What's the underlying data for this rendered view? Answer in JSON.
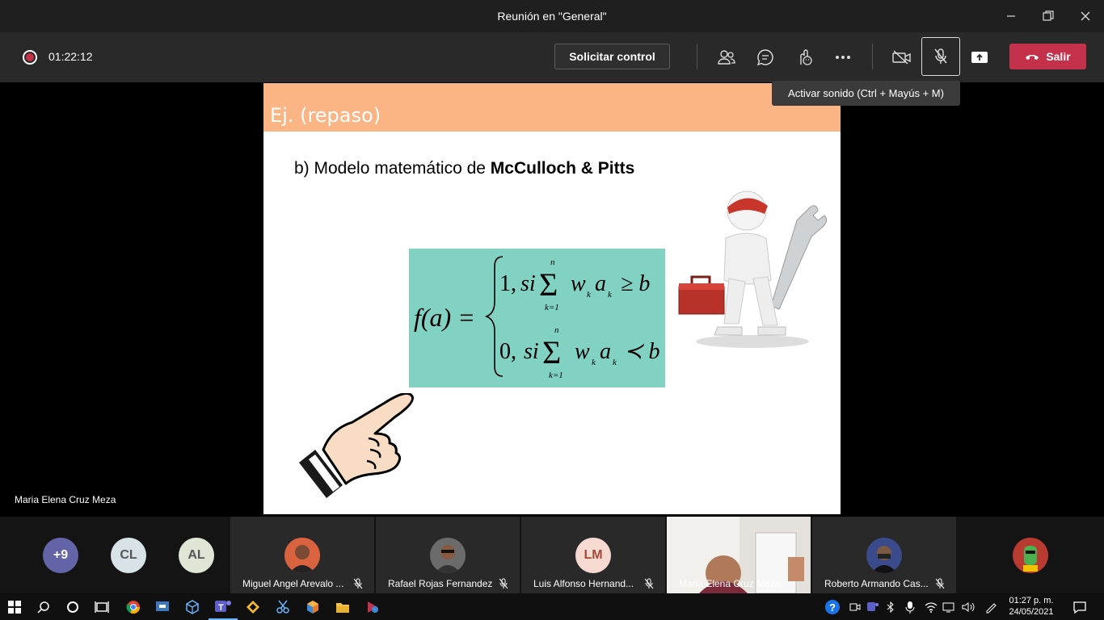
{
  "window": {
    "title": "Reunión en \"General\""
  },
  "toolbar": {
    "timer": "01:22:12",
    "request_control_label": "Solicitar control",
    "leave_label": "Salir",
    "tooltip": "Activar sonido (Ctrl + Mayús + M)"
  },
  "stage": {
    "presenter_name": "Maria Elena Cruz Meza"
  },
  "slide": {
    "title": "Ej. (repaso)",
    "subtitle_prefix": "b) Modelo matemático de ",
    "subtitle_bold_1": "McCulloch & Pitt",
    "subtitle_suffix": "s",
    "formula": {
      "lhs": "f(a) =",
      "case1": "1, si Σ w",
      "case1_rel": "≥ b",
      "case2": "0, si Σ w",
      "case2_rel": "≺ b",
      "sum_top": "n",
      "sum_bottom": "k=1",
      "sub_k": "k",
      "a": "a"
    }
  },
  "participants": {
    "overflow_count": "+9",
    "initials": [
      {
        "text": "CL",
        "bg": "#d8e3e8",
        "fg": "#555"
      },
      {
        "text": "AL",
        "bg": "#dfe6d5",
        "fg": "#555"
      }
    ],
    "tiles": [
      {
        "name": "Miguel Angel Arevalo ..."
      },
      {
        "name": "Rafael Rojas Fernandez"
      },
      {
        "name": "Luis Alfonso Hernand...",
        "initials": "LM"
      },
      {
        "name": "Maria Elena Cruz Meza"
      },
      {
        "name": "Roberto Armando Cas..."
      }
    ]
  },
  "taskbar": {
    "time": "01:27 p. m.",
    "date": "24/05/2021"
  },
  "colors": {
    "leave": "#c4314b",
    "header": "#fbb484",
    "formula_bg": "#82d2c4",
    "accent": "#6264a7"
  }
}
